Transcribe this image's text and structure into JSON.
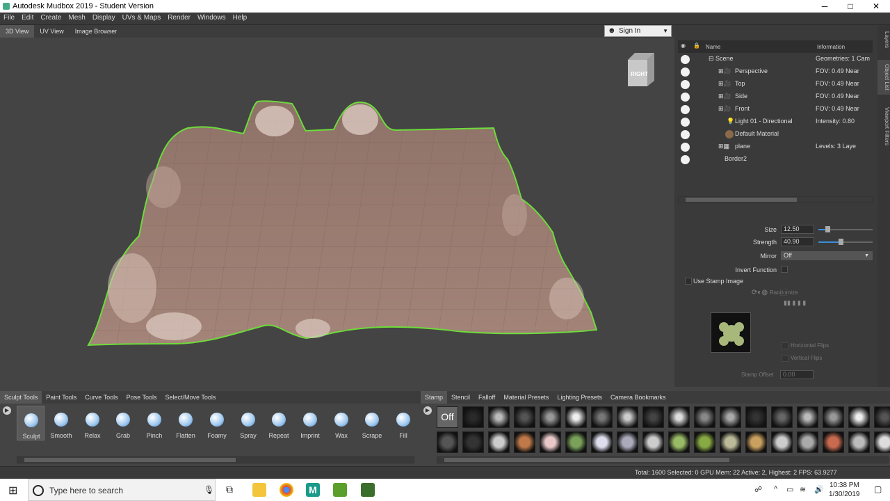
{
  "window": {
    "title": "Autodesk Mudbox 2019 - Student Version",
    "min": "─",
    "max": "□",
    "close": "✕"
  },
  "menu": [
    "File",
    "Edit",
    "Create",
    "Mesh",
    "Display",
    "UVs & Maps",
    "Render",
    "Windows",
    "Help"
  ],
  "view_tabs": [
    "3D View",
    "UV View",
    "Image Browser"
  ],
  "signin": {
    "label": "Sign In",
    "icon": "user-icon"
  },
  "viewcube": {
    "face_label": "RIGHT"
  },
  "side_tabs": [
    "Layers",
    "Object List",
    "Viewport Filters"
  ],
  "object_list": {
    "headers": {
      "name": "Name",
      "info": "Information"
    },
    "rows": [
      {
        "name": "Scene",
        "info": "Geometries: 1   Cam"
      },
      {
        "name": "Perspective",
        "info": "FOV: 0.49      Near"
      },
      {
        "name": "Top",
        "info": "FOV: 0.49      Near"
      },
      {
        "name": "Side",
        "info": "FOV: 0.49      Near"
      },
      {
        "name": "Front",
        "info": "FOV: 0.49      Near"
      },
      {
        "name": "Light 01 - Directional",
        "info": "Intensity: 0.80"
      },
      {
        "name": "Default Material",
        "info": ""
      },
      {
        "name": "plane",
        "info": "Levels: 3      Laye"
      },
      {
        "name": "Border2",
        "info": ""
      }
    ]
  },
  "properties": {
    "size_label": "Size",
    "size_value": "12.50",
    "size_level": 0.17,
    "strength_label": "Strength",
    "strength_value": "40.90",
    "strength_level": 0.41,
    "mirror_label": "Mirror",
    "mirror_value": "Off",
    "invert_label": "Invert Function",
    "use_stamp_label": "Use Stamp Image",
    "randomize_label": "Randomize",
    "horizontal_flips_label": "Horizontal Flips",
    "vertical_flips_label": "Vertical Flips",
    "stamp_offset_label": "Stamp Offset",
    "stamp_offset_value": "0.00"
  },
  "tools_tabs": [
    "Sculpt Tools",
    "Paint Tools",
    "Curve Tools",
    "Pose Tools",
    "Select/Move Tools"
  ],
  "sculpt_tools": [
    "Sculpt",
    "Smooth",
    "Relax",
    "Grab",
    "Pinch",
    "Flatten",
    "Foamy",
    "Spray",
    "Repeat",
    "Imprint",
    "Wax",
    "Scrape",
    "Fill"
  ],
  "stamp_tabs": [
    "Stamp",
    "Stencil",
    "Falloff",
    "Material Presets",
    "Lighting Presets",
    "Camera Bookmarks"
  ],
  "stamp_off_label": "Off",
  "status": {
    "text": "Total: 1600  Selected: 0  GPU Mem: 22  Active: 2, Highest: 2  FPS: 63.9277"
  },
  "taskbar": {
    "search_placeholder": "Type here to search",
    "time": "10:38 PM",
    "date": "1/30/2019"
  },
  "colors": {
    "accent": "#3b8fd9",
    "mesh": "#9b7c70",
    "outline": "#6ddc3a"
  }
}
